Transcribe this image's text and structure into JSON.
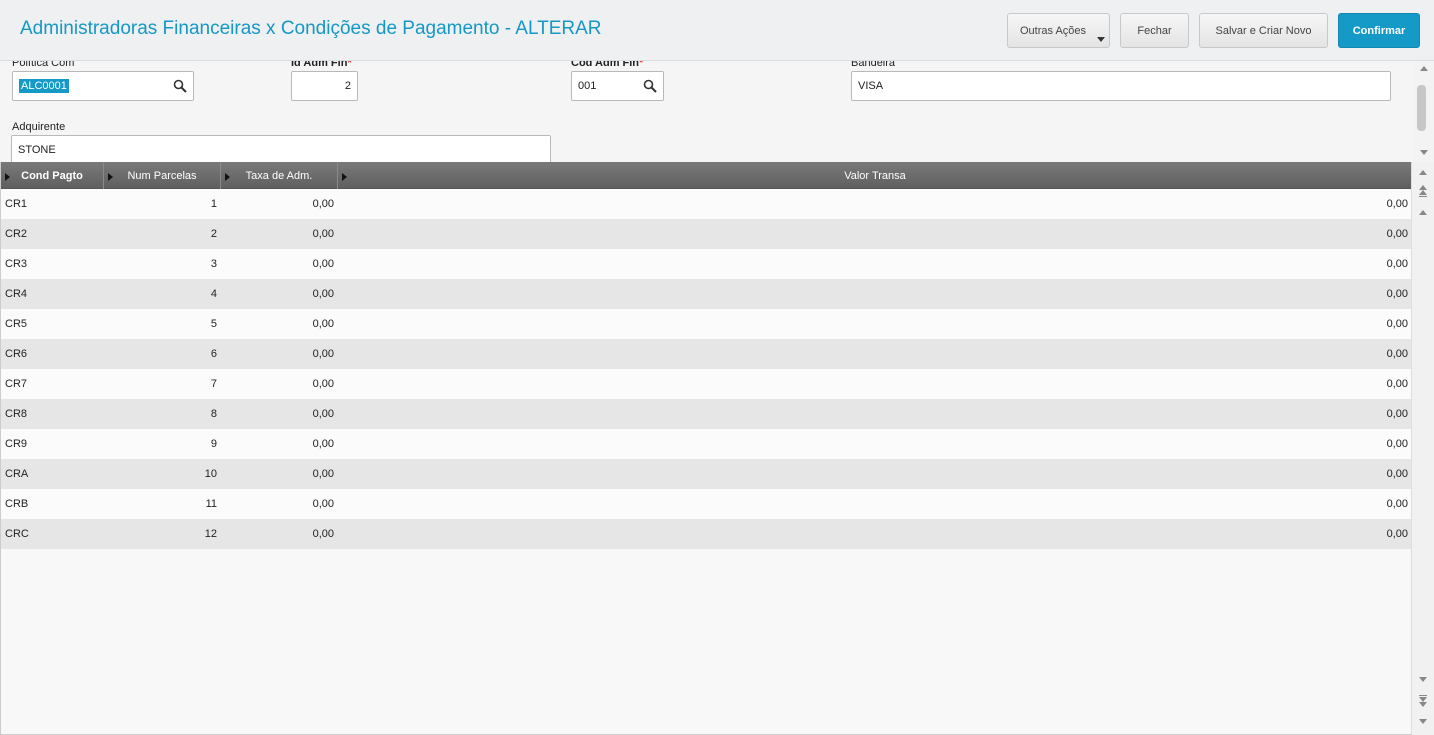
{
  "header": {
    "title": "Administradoras Financeiras x Condições de Pagamento - ALTERAR",
    "buttons": {
      "outras": "Outras Ações",
      "fechar": "Fechar",
      "salvar": "Salvar e Criar Novo",
      "confirmar": "Confirmar"
    }
  },
  "form": {
    "politica": {
      "label": "Política Com",
      "value": "ALC0001",
      "icon": "search-icon"
    },
    "id_adm": {
      "label": "Id Adm Fin",
      "required": "*",
      "value": "2"
    },
    "cod_adm": {
      "label": "Cod Adm Fin",
      "required": "*",
      "value": "001",
      "icon": "search-icon"
    },
    "bandeira": {
      "label": "Bandeira",
      "value": "VISA"
    },
    "adquirente": {
      "label": "Adquirente",
      "value": "STONE"
    }
  },
  "grid": {
    "columns": [
      "Cond Pagto",
      "Num Parcelas",
      "Taxa de Adm.",
      "Valor Transa"
    ],
    "rows": [
      {
        "cond": "CR1",
        "parcelas": "1",
        "taxa": "0,00",
        "valor": "0,00"
      },
      {
        "cond": "CR2",
        "parcelas": "2",
        "taxa": "0,00",
        "valor": "0,00"
      },
      {
        "cond": "CR3",
        "parcelas": "3",
        "taxa": "0,00",
        "valor": "0,00"
      },
      {
        "cond": "CR4",
        "parcelas": "4",
        "taxa": "0,00",
        "valor": "0,00"
      },
      {
        "cond": "CR5",
        "parcelas": "5",
        "taxa": "0,00",
        "valor": "0,00"
      },
      {
        "cond": "CR6",
        "parcelas": "6",
        "taxa": "0,00",
        "valor": "0,00"
      },
      {
        "cond": "CR7",
        "parcelas": "7",
        "taxa": "0,00",
        "valor": "0,00"
      },
      {
        "cond": "CR8",
        "parcelas": "8",
        "taxa": "0,00",
        "valor": "0,00"
      },
      {
        "cond": "CR9",
        "parcelas": "9",
        "taxa": "0,00",
        "valor": "0,00"
      },
      {
        "cond": "CRA",
        "parcelas": "10",
        "taxa": "0,00",
        "valor": "0,00"
      },
      {
        "cond": "CRB",
        "parcelas": "11",
        "taxa": "0,00",
        "valor": "0,00"
      },
      {
        "cond": "CRC",
        "parcelas": "12",
        "taxa": "0,00",
        "valor": "0,00"
      }
    ]
  },
  "colors": {
    "accent": "#1599c7",
    "header_bg": "#eef0f2",
    "grid_head": "#6e6e6e",
    "required": "#e03030"
  }
}
